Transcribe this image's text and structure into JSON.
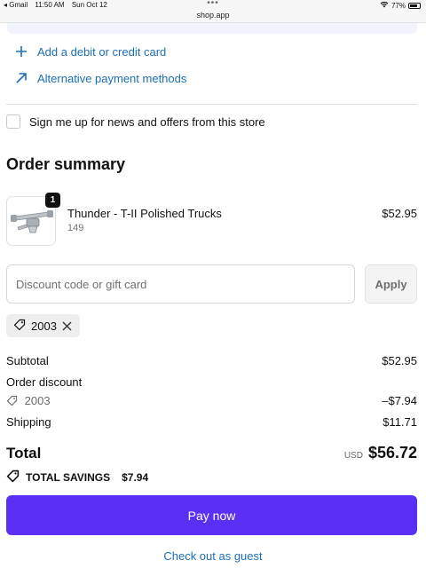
{
  "statusbar": {
    "back_app": "◂ Gmail",
    "time": "11:50 AM",
    "date": "Sun Oct 12",
    "dots": "•••",
    "url": "shop.app",
    "battery": "77%",
    "battery_level": 0.77
  },
  "payment": {
    "add_card_label": "Add a debit or credit card",
    "alt_methods_label": "Alternative payment methods"
  },
  "newsletter": {
    "label": "Sign me up for news and offers from this store",
    "checked": false
  },
  "summary": {
    "title": "Order summary",
    "product": {
      "quantity": "1",
      "name": "Thunder - T-II Polished Trucks",
      "variant": "149",
      "price": "$52.95"
    },
    "discount": {
      "placeholder": "Discount code or gift card",
      "value": "",
      "apply_label": "Apply"
    },
    "applied_code": "2003",
    "subtotal_label": "Subtotal",
    "subtotal_value": "$52.95",
    "order_discount_label": "Order discount",
    "discount_code_label": "2003",
    "discount_value": "–$7.94",
    "shipping_label": "Shipping",
    "shipping_value": "$11.71",
    "total_label": "Total",
    "total_currency": "USD",
    "total_value": "$56.72",
    "savings_label": "TOTAL SAVINGS",
    "savings_value": "$7.94"
  },
  "actions": {
    "pay_label": "Pay now",
    "guest_label": "Check out as guest"
  },
  "colors": {
    "accent": "#5a31f4",
    "link": "#1a6fb8"
  }
}
